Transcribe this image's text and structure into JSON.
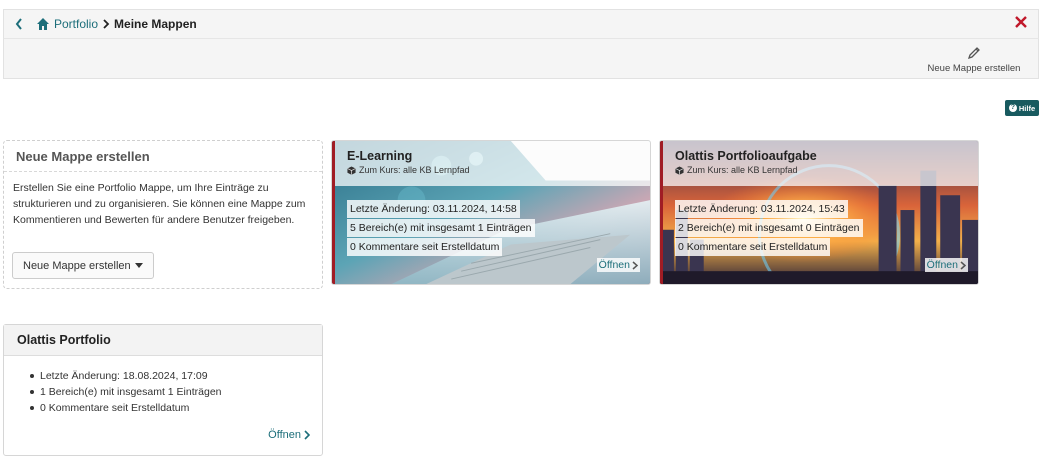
{
  "breadcrumb": {
    "root": "Portfolio",
    "current": "Meine Mappen"
  },
  "toolbar": {
    "new_label": "Neue Mappe erstellen"
  },
  "help": {
    "label": "Hilfe",
    "icon": "?"
  },
  "new_card": {
    "title": "Neue Mappe erstellen",
    "description": "Erstellen Sie eine Portfolio Mappe, um Ihre Einträge zu strukturieren und zu organisieren. Sie können eine Mappe zum Kommentieren und Bewerten für andere Benutzer freigeben.",
    "button_label": "Neue Mappe erstellen"
  },
  "cards": [
    {
      "title": "E-Learning",
      "course": "Zum Kurs: alle KB Lernpfad",
      "last_change": "Letzte Änderung: 03.11.2024, 14:58",
      "sections": "5 Bereich(e) mit insgesamt 1 Einträgen",
      "comments": "0 Kommentare seit Erstelldatum",
      "open_label": "Öffnen"
    },
    {
      "title": "Olattis Portfolioaufgabe",
      "course": "Zum Kurs: alle KB Lernpfad",
      "last_change": "Letzte Änderung: 03.11.2024, 15:43",
      "sections": "2 Bereich(e) mit insgesamt 0 Einträgen",
      "comments": "0 Kommentare seit Erstelldatum",
      "open_label": "Öffnen"
    }
  ],
  "list_card": {
    "title": "Olattis Portfolio",
    "items": [
      "Letzte Änderung: 18.08.2024, 17:09",
      "1 Bereich(e) mit insgesamt 1 Einträgen",
      "0 Kommentare seit Erstelldatum"
    ],
    "open_label": "Öffnen"
  },
  "colors": {
    "link": "#1c6e7a",
    "accent": "#a01c24",
    "close": "#c0182a",
    "help_bg": "#185a5f"
  }
}
